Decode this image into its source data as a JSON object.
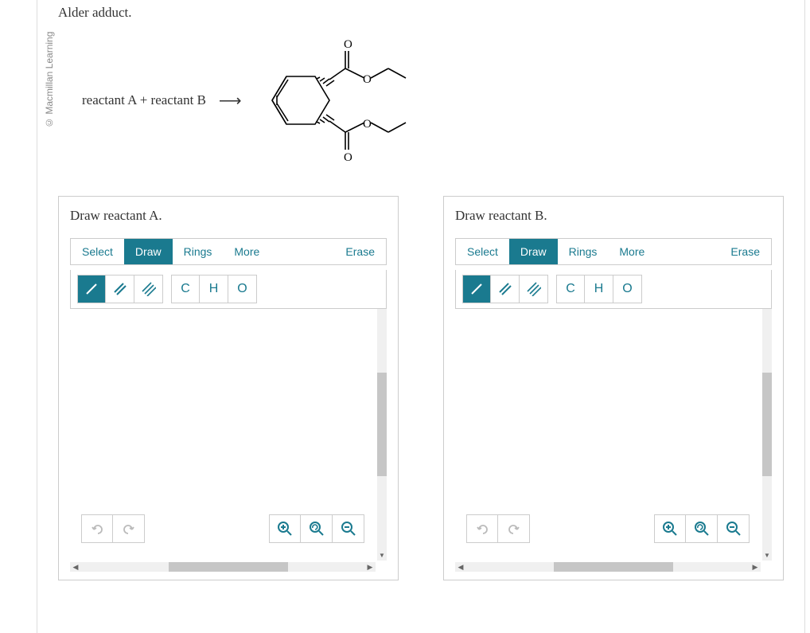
{
  "copyright": "© Macmillan Learning",
  "intro_text": "Alder adduct.",
  "reaction_label": "reactant A + reactant B",
  "panels": [
    {
      "title": "Draw reactant A."
    },
    {
      "title": "Draw reactant B."
    }
  ],
  "toolbar": {
    "select": "Select",
    "draw": "Draw",
    "rings": "Rings",
    "more": "More",
    "erase": "Erase"
  },
  "atoms": {
    "c": "C",
    "h": "H",
    "o": "O"
  }
}
